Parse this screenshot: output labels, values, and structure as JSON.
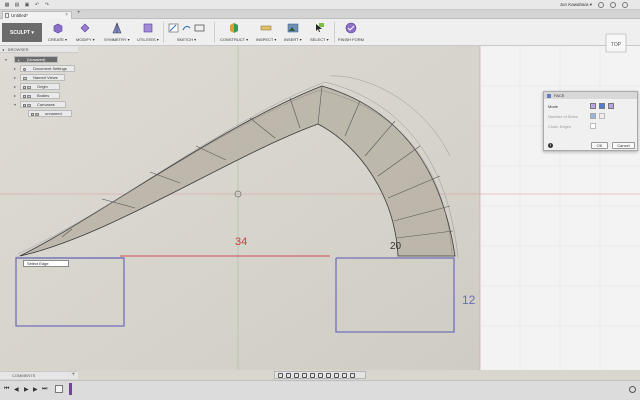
{
  "app": {
    "user_name": "Jun Kawahara ▾",
    "tab_title": "Untitled*"
  },
  "toolbar": {
    "mode_label": "SCULPT ▾",
    "groups": [
      {
        "label": "CREATE ▾"
      },
      {
        "label": "MODIFY ▾"
      },
      {
        "label": "SYMMETRY ▾"
      },
      {
        "label": "UTILITIES ▾"
      },
      {
        "label": "SKETCH ▾"
      },
      {
        "label": "CONSTRUCT ▾"
      },
      {
        "label": "INSPECT ▾"
      },
      {
        "label": "INSERT ▾"
      },
      {
        "label": "SELECT ▾"
      },
      {
        "label": "FINISH FORM"
      }
    ]
  },
  "browser": {
    "header": "BROWSER",
    "root": "(Unsaved)",
    "items": [
      "Document Settings",
      "Named Views",
      "Origin",
      "Bodies",
      "Canvases",
      "unnamed"
    ]
  },
  "canvas": {
    "sketch_labels": [
      "34",
      "20",
      "12"
    ],
    "tooltip": "Select Edge"
  },
  "face_dialog": {
    "title": "FACE",
    "mode_label": "Mode",
    "num_sides_label": "Number of Sides",
    "chain_label": "Chain Edges",
    "ok_label": "OK",
    "cancel_label": "Cancel"
  },
  "view_cube": {
    "face": "TOP"
  },
  "comments": {
    "label": "COMMENTS"
  },
  "colors": {
    "accent": "#7a3f9c",
    "sculpt_bg": "#6b6b6b",
    "surface": "#b8b3a6"
  }
}
